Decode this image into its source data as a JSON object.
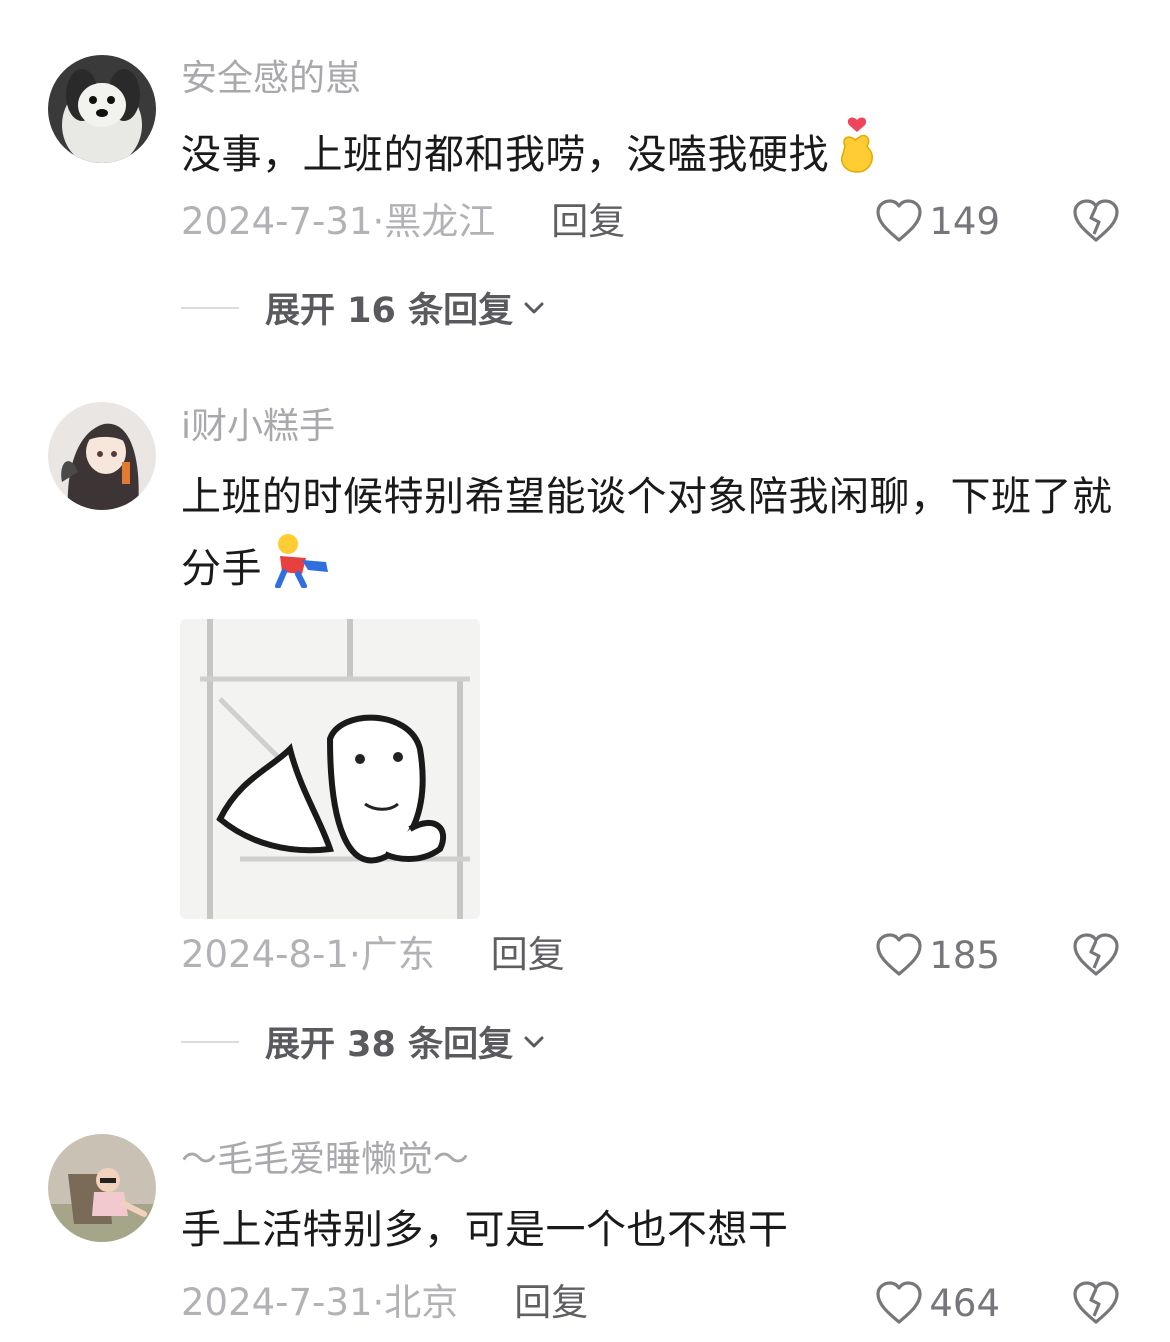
{
  "comments": [
    {
      "username": "安全感的崽",
      "text": "没事，上班的都和我唠，没嗑我硬找",
      "date": "2024-7-31",
      "location": "黑龙江",
      "reply_label": "回复",
      "likes": "149",
      "expand_label": "展开 16 条回复",
      "avatar_icon": "dog-plush-avatar",
      "emoji": "finger-heart-emoji"
    },
    {
      "username": "i财小糕手",
      "text": "上班的时候特别希望能谈个对象陪我闲聊，下班了就分手",
      "date": "2024-8-1",
      "location": "广东",
      "reply_label": "回复",
      "likes": "185",
      "expand_label": "展开 38 条回复",
      "avatar_icon": "anime-girl-avatar",
      "emoji": "falling-person-emoji",
      "image": "meme-sticker"
    },
    {
      "username": "～毛毛爱睡懒觉～",
      "text": "手上活特别多，可是一个也不想干",
      "date": "2024-7-31",
      "location": "北京",
      "reply_label": "回复",
      "likes": "464",
      "avatar_icon": "child-in-chair-avatar"
    }
  ],
  "separator": "·",
  "colors": {
    "meta": "#b2b2b6",
    "username": "#a9a9ad",
    "text": "#1a1a1a",
    "icon": "#77777b"
  }
}
